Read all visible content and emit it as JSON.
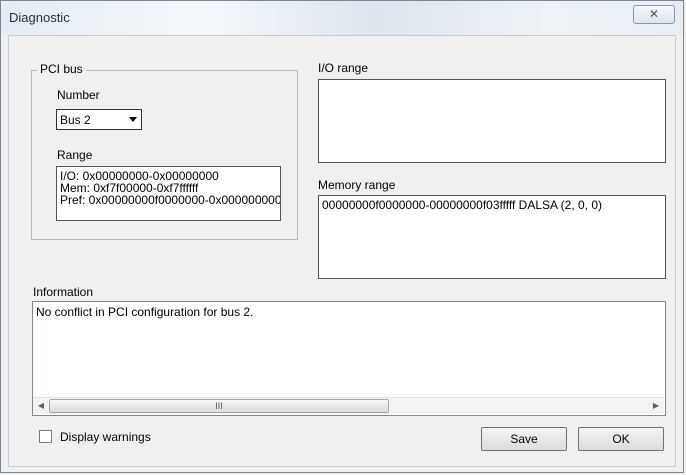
{
  "window": {
    "title": "Diagnostic",
    "close_glyph": "✕"
  },
  "pci_bus": {
    "group_label": "PCI bus",
    "number_label": "Number",
    "bus_select": {
      "value": "Bus 2"
    },
    "range_label": "Range",
    "range_lines": [
      "I/O: 0x00000000-0x00000000",
      "Mem: 0xf7f00000-0xf7ffffff",
      "Pref: 0x00000000f0000000-0x000000000"
    ]
  },
  "io_range": {
    "label": "I/O range",
    "lines": []
  },
  "memory_range": {
    "label": "Memory range",
    "lines": [
      "00000000f0000000-00000000f03fffff DALSA (2, 0, 0)"
    ]
  },
  "information": {
    "label": "Information",
    "text": "No conflict in PCI configuration for bus 2.",
    "scroll_thumb_glyph": "III",
    "scroll_left_glyph": "◀",
    "scroll_right_glyph": "▶"
  },
  "footer": {
    "display_warnings_label": "Display warnings",
    "display_warnings_checked": false,
    "save_label": "Save",
    "ok_label": "OK"
  }
}
